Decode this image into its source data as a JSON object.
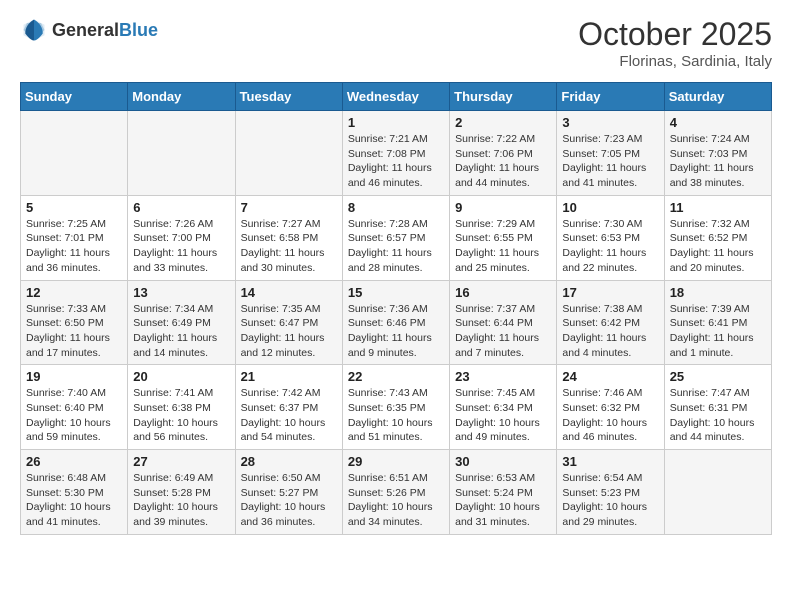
{
  "header": {
    "logo_general": "General",
    "logo_blue": "Blue",
    "month": "October 2025",
    "location": "Florinas, Sardinia, Italy"
  },
  "weekdays": [
    "Sunday",
    "Monday",
    "Tuesday",
    "Wednesday",
    "Thursday",
    "Friday",
    "Saturday"
  ],
  "weeks": [
    [
      {
        "day": "",
        "info": ""
      },
      {
        "day": "",
        "info": ""
      },
      {
        "day": "",
        "info": ""
      },
      {
        "day": "1",
        "info": "Sunrise: 7:21 AM\nSunset: 7:08 PM\nDaylight: 11 hours and 46 minutes."
      },
      {
        "day": "2",
        "info": "Sunrise: 7:22 AM\nSunset: 7:06 PM\nDaylight: 11 hours and 44 minutes."
      },
      {
        "day": "3",
        "info": "Sunrise: 7:23 AM\nSunset: 7:05 PM\nDaylight: 11 hours and 41 minutes."
      },
      {
        "day": "4",
        "info": "Sunrise: 7:24 AM\nSunset: 7:03 PM\nDaylight: 11 hours and 38 minutes."
      }
    ],
    [
      {
        "day": "5",
        "info": "Sunrise: 7:25 AM\nSunset: 7:01 PM\nDaylight: 11 hours and 36 minutes."
      },
      {
        "day": "6",
        "info": "Sunrise: 7:26 AM\nSunset: 7:00 PM\nDaylight: 11 hours and 33 minutes."
      },
      {
        "day": "7",
        "info": "Sunrise: 7:27 AM\nSunset: 6:58 PM\nDaylight: 11 hours and 30 minutes."
      },
      {
        "day": "8",
        "info": "Sunrise: 7:28 AM\nSunset: 6:57 PM\nDaylight: 11 hours and 28 minutes."
      },
      {
        "day": "9",
        "info": "Sunrise: 7:29 AM\nSunset: 6:55 PM\nDaylight: 11 hours and 25 minutes."
      },
      {
        "day": "10",
        "info": "Sunrise: 7:30 AM\nSunset: 6:53 PM\nDaylight: 11 hours and 22 minutes."
      },
      {
        "day": "11",
        "info": "Sunrise: 7:32 AM\nSunset: 6:52 PM\nDaylight: 11 hours and 20 minutes."
      }
    ],
    [
      {
        "day": "12",
        "info": "Sunrise: 7:33 AM\nSunset: 6:50 PM\nDaylight: 11 hours and 17 minutes."
      },
      {
        "day": "13",
        "info": "Sunrise: 7:34 AM\nSunset: 6:49 PM\nDaylight: 11 hours and 14 minutes."
      },
      {
        "day": "14",
        "info": "Sunrise: 7:35 AM\nSunset: 6:47 PM\nDaylight: 11 hours and 12 minutes."
      },
      {
        "day": "15",
        "info": "Sunrise: 7:36 AM\nSunset: 6:46 PM\nDaylight: 11 hours and 9 minutes."
      },
      {
        "day": "16",
        "info": "Sunrise: 7:37 AM\nSunset: 6:44 PM\nDaylight: 11 hours and 7 minutes."
      },
      {
        "day": "17",
        "info": "Sunrise: 7:38 AM\nSunset: 6:42 PM\nDaylight: 11 hours and 4 minutes."
      },
      {
        "day": "18",
        "info": "Sunrise: 7:39 AM\nSunset: 6:41 PM\nDaylight: 11 hours and 1 minute."
      }
    ],
    [
      {
        "day": "19",
        "info": "Sunrise: 7:40 AM\nSunset: 6:40 PM\nDaylight: 10 hours and 59 minutes."
      },
      {
        "day": "20",
        "info": "Sunrise: 7:41 AM\nSunset: 6:38 PM\nDaylight: 10 hours and 56 minutes."
      },
      {
        "day": "21",
        "info": "Sunrise: 7:42 AM\nSunset: 6:37 PM\nDaylight: 10 hours and 54 minutes."
      },
      {
        "day": "22",
        "info": "Sunrise: 7:43 AM\nSunset: 6:35 PM\nDaylight: 10 hours and 51 minutes."
      },
      {
        "day": "23",
        "info": "Sunrise: 7:45 AM\nSunset: 6:34 PM\nDaylight: 10 hours and 49 minutes."
      },
      {
        "day": "24",
        "info": "Sunrise: 7:46 AM\nSunset: 6:32 PM\nDaylight: 10 hours and 46 minutes."
      },
      {
        "day": "25",
        "info": "Sunrise: 7:47 AM\nSunset: 6:31 PM\nDaylight: 10 hours and 44 minutes."
      }
    ],
    [
      {
        "day": "26",
        "info": "Sunrise: 6:48 AM\nSunset: 5:30 PM\nDaylight: 10 hours and 41 minutes."
      },
      {
        "day": "27",
        "info": "Sunrise: 6:49 AM\nSunset: 5:28 PM\nDaylight: 10 hours and 39 minutes."
      },
      {
        "day": "28",
        "info": "Sunrise: 6:50 AM\nSunset: 5:27 PM\nDaylight: 10 hours and 36 minutes."
      },
      {
        "day": "29",
        "info": "Sunrise: 6:51 AM\nSunset: 5:26 PM\nDaylight: 10 hours and 34 minutes."
      },
      {
        "day": "30",
        "info": "Sunrise: 6:53 AM\nSunset: 5:24 PM\nDaylight: 10 hours and 31 minutes."
      },
      {
        "day": "31",
        "info": "Sunrise: 6:54 AM\nSunset: 5:23 PM\nDaylight: 10 hours and 29 minutes."
      },
      {
        "day": "",
        "info": ""
      }
    ]
  ]
}
